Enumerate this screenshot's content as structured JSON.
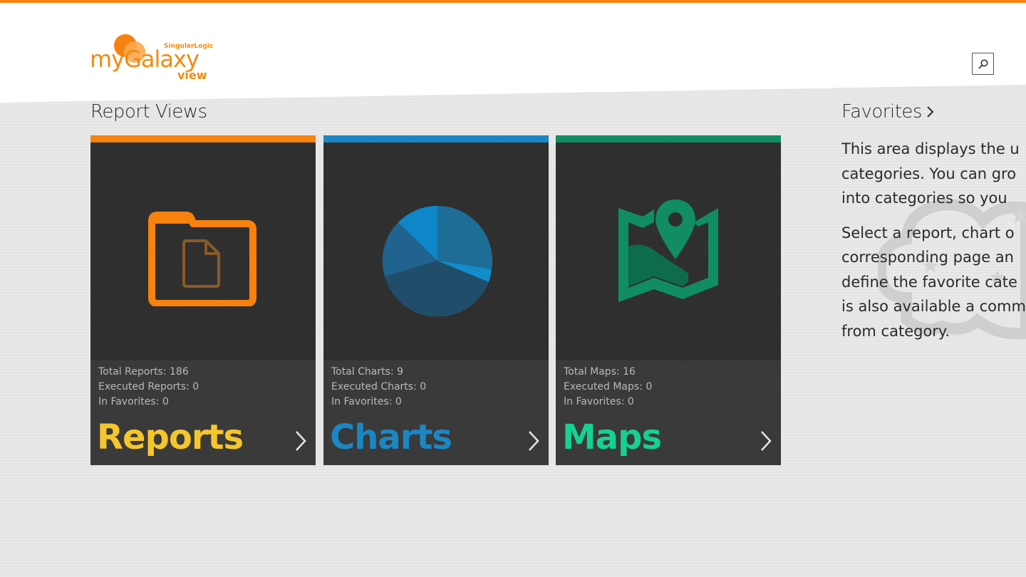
{
  "app": {
    "logo_text": "myGalaxy",
    "logo_sub": "view",
    "logo_maker": "SingularLogic"
  },
  "header": {
    "search_icon": "search-icon"
  },
  "report_views": {
    "title": "Report Views",
    "tiles": [
      {
        "title": "Reports",
        "accent": "#f7820f",
        "title_color": "#f5c62a",
        "icon": "folder-document-icon",
        "stats": [
          "Total Reports: 186",
          "Executed Reports: 0",
          "In Favorites: 0"
        ]
      },
      {
        "title": "Charts",
        "accent": "#1a87c4",
        "title_color": "#1a87c4",
        "icon": "pie-chart-icon",
        "stats": [
          "Total Charts: 9",
          "Executed Charts: 0",
          "In Favorites: 0"
        ]
      },
      {
        "title": "Maps",
        "accent": "#108d63",
        "title_color": "#16d18f",
        "icon": "map-pin-icon",
        "stats": [
          "Total Maps: 16",
          "Executed Maps: 0",
          "In Favorites: 0"
        ]
      }
    ]
  },
  "favorites": {
    "title": "Favorites",
    "chevron": "chevron-right-icon",
    "paragraph1": [
      "This area displays the u",
      "categories. You can gro",
      "into categories so you"
    ],
    "paragraph2": [
      "Select a report, chart o",
      "corresponding page an",
      "define the favorite cate",
      "is also available a comm",
      "from category."
    ]
  }
}
